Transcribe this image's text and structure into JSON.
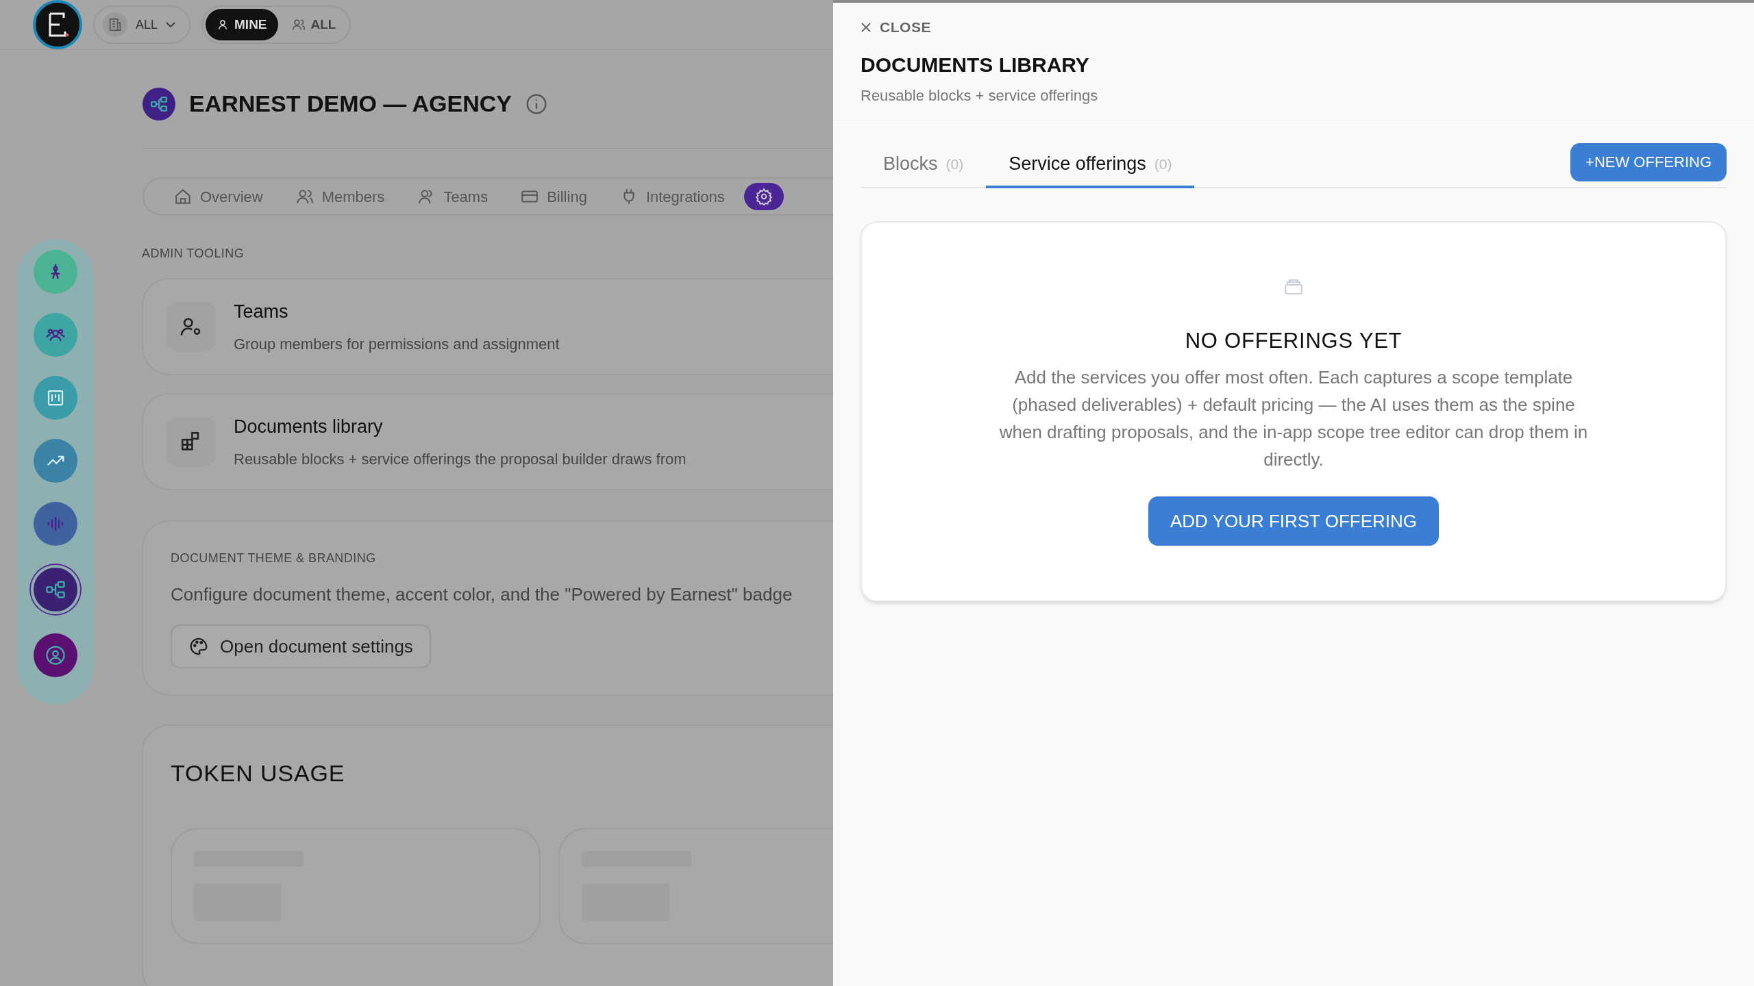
{
  "top_bar": {
    "workspace_filter": {
      "label": "ALL"
    },
    "scope_toggle": [
      {
        "label": "MINE",
        "selected": true
      },
      {
        "label": "ALL",
        "selected": false
      }
    ]
  },
  "rail": [
    {
      "color": "#4bb394",
      "selected": false
    },
    {
      "color": "#3ea6a2",
      "selected": false
    },
    {
      "color": "#3a9ba9",
      "selected": false
    },
    {
      "color": "#3a82a6",
      "selected": false
    },
    {
      "color": "#3e63a0",
      "selected": false
    },
    {
      "color": "#3b2173",
      "selected": true
    },
    {
      "color": "#5b0f70",
      "selected": false
    }
  ],
  "org": {
    "title": "EARNEST DEMO — AGENCY"
  },
  "tabs": [
    {
      "label": "Overview",
      "selected": false
    },
    {
      "label": "Members",
      "selected": false
    },
    {
      "label": "Teams",
      "selected": false
    },
    {
      "label": "Billing",
      "selected": false
    },
    {
      "label": "Integrations",
      "selected": false
    },
    {
      "selected": true
    }
  ],
  "admin_tooling": {
    "heading": "ADMIN TOOLING",
    "items": [
      {
        "title": "Teams",
        "description": "Group members for permissions and assignment"
      },
      {
        "title": "Documents library",
        "description": "Reusable blocks + service offerings the proposal builder draws from"
      }
    ]
  },
  "theme_card": {
    "heading": "DOCUMENT THEME & BRANDING",
    "text": "Configure document theme, accent color, and the \"Powered by Earnest\" badge",
    "button": "Open document settings"
  },
  "token_usage": {
    "title": "TOKEN USAGE"
  },
  "drawer": {
    "close": "CLOSE",
    "title": "DOCUMENTS LIBRARY",
    "subtitle": "Reusable blocks + service offerings",
    "tabs": [
      {
        "label": "Blocks",
        "count": "(0)",
        "selected": false
      },
      {
        "label": "Service offerings",
        "count": "(0)",
        "selected": true
      }
    ],
    "new_button": "+NEW OFFERING",
    "empty": {
      "title": "NO OFFERINGS YET",
      "text": "Add the services you offer most often. Each captures a scope template (phased deliverables) + default pricing — the AI uses them as the spine when drafting proposals, and the in-app scope tree editor can drop them in directly.",
      "button": "ADD YOUR FIRST OFFERING"
    }
  }
}
